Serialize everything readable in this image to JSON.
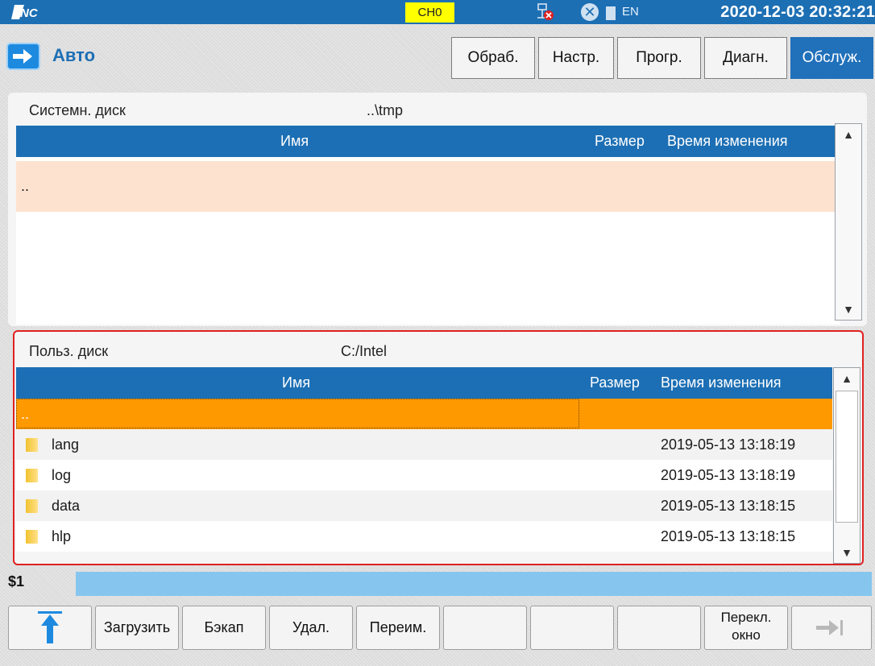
{
  "topbar": {
    "channel": "CH0",
    "lang": "EN",
    "datetime": "2020-12-03 20:32:21",
    "icons": [
      "logo-icon",
      "network-disconnected-icon",
      "close-icon",
      "battery-icon"
    ]
  },
  "mode": {
    "label": "Авто"
  },
  "nav": {
    "tabs": [
      {
        "label": "Обраб."
      },
      {
        "label": "Настр."
      },
      {
        "label": "Прогр."
      },
      {
        "label": "Диагн."
      },
      {
        "label": "Обслуж."
      }
    ],
    "active_index": 4
  },
  "system_panel": {
    "disk_label": "Системн. диск",
    "path": "..\\tmp",
    "columns": {
      "name": "Имя",
      "size": "Размер",
      "modified": "Время изменения"
    },
    "rows": [
      {
        "name": "..",
        "size": "",
        "modified": ""
      }
    ]
  },
  "user_panel": {
    "disk_label": "Польз. диск",
    "path": "C:/Intel",
    "columns": {
      "name": "Имя",
      "size": "Размер",
      "modified": "Время изменения"
    },
    "rows": [
      {
        "name": "..",
        "size": "",
        "modified": ""
      },
      {
        "name": "lang",
        "size": "",
        "modified": "2019-05-13 13:18:19"
      },
      {
        "name": "log",
        "size": "",
        "modified": "2019-05-13 13:18:19"
      },
      {
        "name": "data",
        "size": "",
        "modified": "2019-05-13 13:18:15"
      },
      {
        "name": "hlp",
        "size": "",
        "modified": "2019-05-13 13:18:15"
      }
    ]
  },
  "command": {
    "prompt": "$1",
    "value": ""
  },
  "toolbar": {
    "load": "Загрузить",
    "backup": "Бэкап",
    "delete": "Удал.",
    "rename": "Переим.",
    "switch_line1": "Перекл.",
    "switch_line2": "окно"
  },
  "colors": {
    "accent": "#1d6fb4",
    "header": "#1c6fb4",
    "selected_row": "#ff9900",
    "highlight_row": "#fde3cf",
    "channel_badge": "#ffff00",
    "focus_border": "#e02020",
    "command_field": "#86c6ee"
  }
}
